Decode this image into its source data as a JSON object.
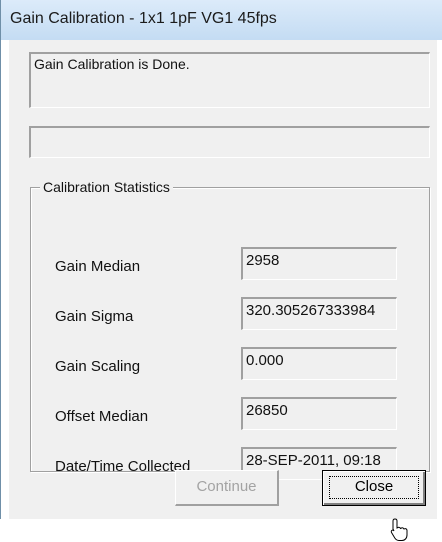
{
  "window": {
    "title": "Gain Calibration - 1x1 1pF VG1 45fps"
  },
  "status": {
    "message": "Gain Calibration is Done.",
    "progress": 0
  },
  "statistics": {
    "group_label": "Calibration Statistics",
    "items": [
      {
        "label": "Gain Median",
        "value": "2958"
      },
      {
        "label": "Gain Sigma",
        "value": "320.305267333984"
      },
      {
        "label": "Gain Scaling",
        "value": "0.000"
      },
      {
        "label": "Offset Median",
        "value": "26850"
      },
      {
        "label": "Date/Time Collected",
        "value": "28-SEP-2011, 09:18"
      }
    ]
  },
  "buttons": {
    "continue": {
      "label": "Continue",
      "enabled": false
    },
    "close": {
      "label": "Close",
      "enabled": true
    }
  },
  "icons": {
    "cursor": "hand-pointer-icon"
  }
}
